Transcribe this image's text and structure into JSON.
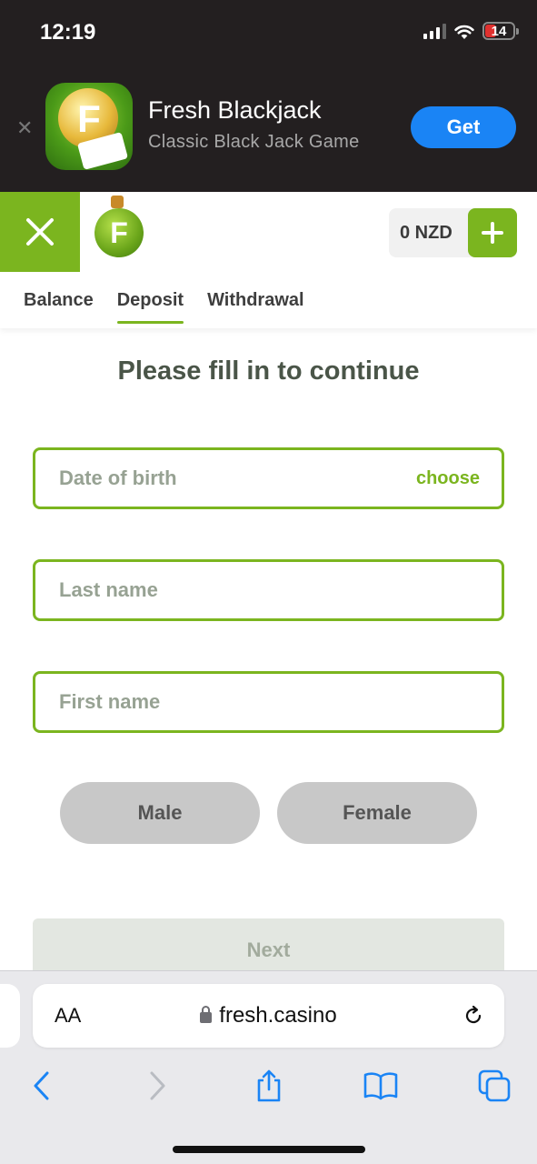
{
  "status_bar": {
    "time": "12:19",
    "battery": "14"
  },
  "app_banner": {
    "title": "Fresh Blackjack",
    "subtitle": "Classic Black Jack Game",
    "get_label": "Get",
    "icon_letter": "F"
  },
  "header": {
    "logo_letter": "F",
    "balance": "0 NZD",
    "tabs": [
      {
        "label": "Balance",
        "active": false
      },
      {
        "label": "Deposit",
        "active": true
      },
      {
        "label": "Withdrawal",
        "active": false
      }
    ]
  },
  "form": {
    "title": "Please fill in to continue",
    "dob_placeholder": "Date of birth",
    "dob_action": "choose",
    "last_name_placeholder": "Last name",
    "first_name_placeholder": "First name",
    "gender_male": "Male",
    "gender_female": "Female",
    "next_label": "Next"
  },
  "browser": {
    "aa_label": "AA",
    "url": "fresh.casino"
  },
  "colors": {
    "accent_green": "#7bb51f",
    "banner_bg": "#231f20",
    "get_blue": "#1a84f5",
    "safari_blue": "#1a84f5"
  }
}
